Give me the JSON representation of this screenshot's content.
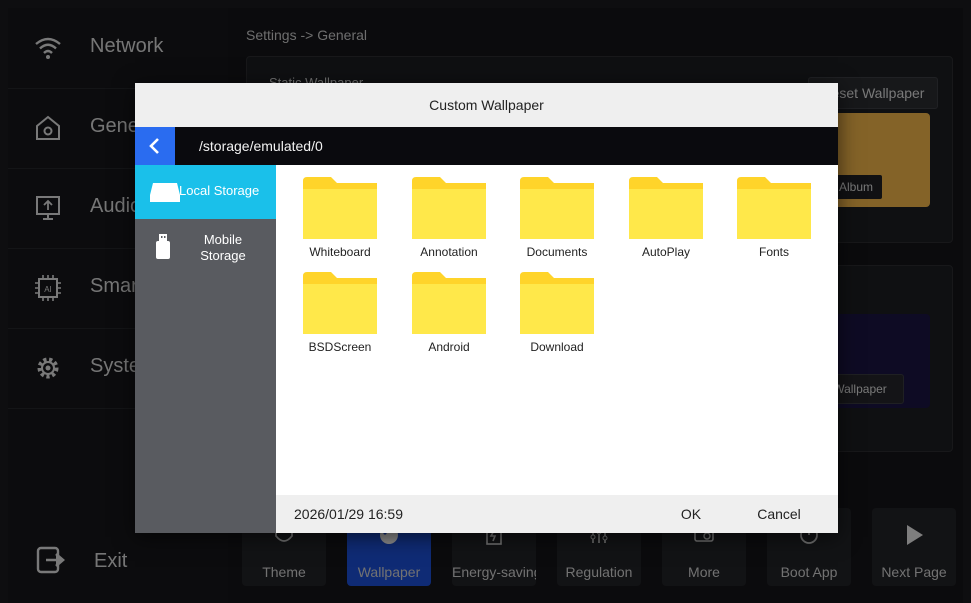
{
  "sidebar": {
    "items": [
      {
        "label": "Network",
        "icon": "wifi-icon"
      },
      {
        "label": "General",
        "icon": "home-settings-icon"
      },
      {
        "label": "Audio",
        "icon": "monitor-icon"
      },
      {
        "label": "Smart",
        "icon": "ai-chip-icon"
      },
      {
        "label": "System",
        "icon": "gear-icon"
      }
    ],
    "exit_label": "Exit"
  },
  "breadcrumb": "Settings -> General",
  "panels": {
    "static_title": "Static Wallpaper",
    "reset_label": "Reset Wallpaper",
    "album_label": "Album",
    "wallpaper_label": "Wallpaper"
  },
  "bottom_bar": [
    {
      "label": "Theme",
      "icon": "theme-icon"
    },
    {
      "label": "Wallpaper",
      "icon": "palette-icon"
    },
    {
      "label": "Energy-saving",
      "icon": "energy-icon"
    },
    {
      "label": "Regulation",
      "icon": "sliders-icon"
    },
    {
      "label": "More",
      "icon": "more-icon"
    },
    {
      "label": "Boot App",
      "icon": "power-icon"
    },
    {
      "label": "Next Page",
      "icon": "play-icon"
    }
  ],
  "dialog": {
    "title": "Custom Wallpaper",
    "path": "/storage/emulated/0",
    "storage": [
      {
        "label": "Local Storage"
      },
      {
        "label": "Mobile Storage"
      }
    ],
    "folders": [
      {
        "name": "Whiteboard"
      },
      {
        "name": "Annotation"
      },
      {
        "name": "Documents"
      },
      {
        "name": "AutoPlay"
      },
      {
        "name": "Fonts"
      },
      {
        "name": "BSDScreen"
      },
      {
        "name": "Android"
      },
      {
        "name": "Download"
      }
    ],
    "datetime": "2026/01/29 16:59",
    "ok_label": "OK",
    "cancel_label": "Cancel"
  },
  "colors": {
    "accent_blue": "#2a6cf0",
    "local_storage_active": "#1ac0ea",
    "folder_yellow": "#ffe84a"
  }
}
